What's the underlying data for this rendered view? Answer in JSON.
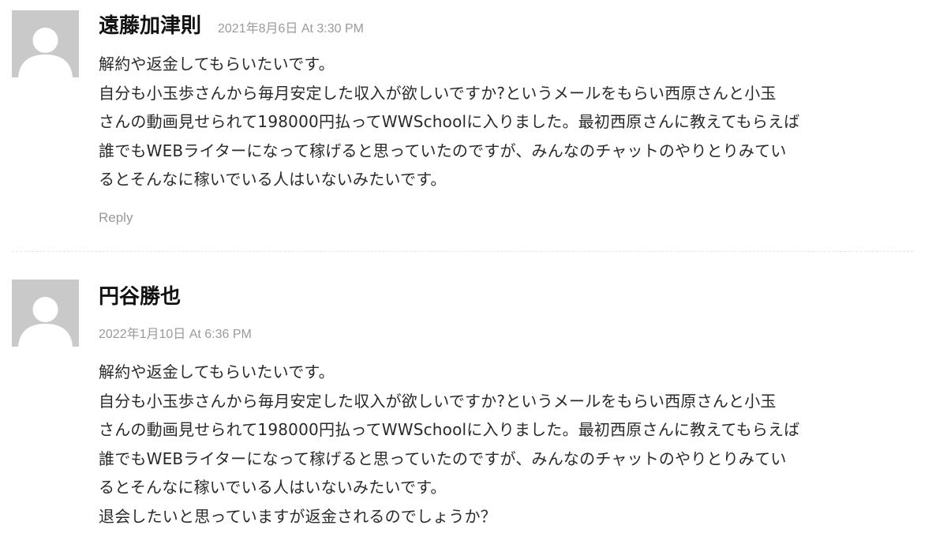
{
  "comments": [
    {
      "author": "遠藤加津則",
      "date": "2021年8月6日 At 3:30 PM",
      "avatar_icon": "default-avatar-icon",
      "lines": [
        "解約や返金してもらいたいです。",
        "自分も小玉歩さんから毎月安定した収入が欲しいですか?というメールをもらい西原さんと小玉",
        "さんの動画見せられて198000円払ってWWSchoolに入りました。最初西原さんに教えてもらえば",
        "誰でもWEBライターになって稼げると思っていたのですが、みんなのチャットのやりとりみてい",
        "るとそんなに稼いでいる人はいないみたいです。"
      ],
      "reply_label": "Reply"
    },
    {
      "author": "円谷勝也",
      "date": "2022年1月10日 At 6:36 PM",
      "avatar_icon": "default-avatar-icon",
      "lines": [
        "解約や返金してもらいたいです。",
        "自分も小玉歩さんから毎月安定した収入が欲しいですか?というメールをもらい西原さんと小玉",
        "さんの動画見せられて198000円払ってWWSchoolに入りました。最初西原さんに教えてもらえば",
        "誰でもWEBライターになって稼げると思っていたのですが、みんなのチャットのやりとりみてい",
        "るとそんなに稼いでいる人はいないみたいです。",
        "退会したいと思っていますが返金されるのでしょうか？"
      ]
    }
  ],
  "colors": {
    "avatar_bg": "#c9c9c9",
    "avatar_fg": "#ffffff",
    "meta_text": "#9a9a9a",
    "body_text": "#2a2a2a"
  }
}
